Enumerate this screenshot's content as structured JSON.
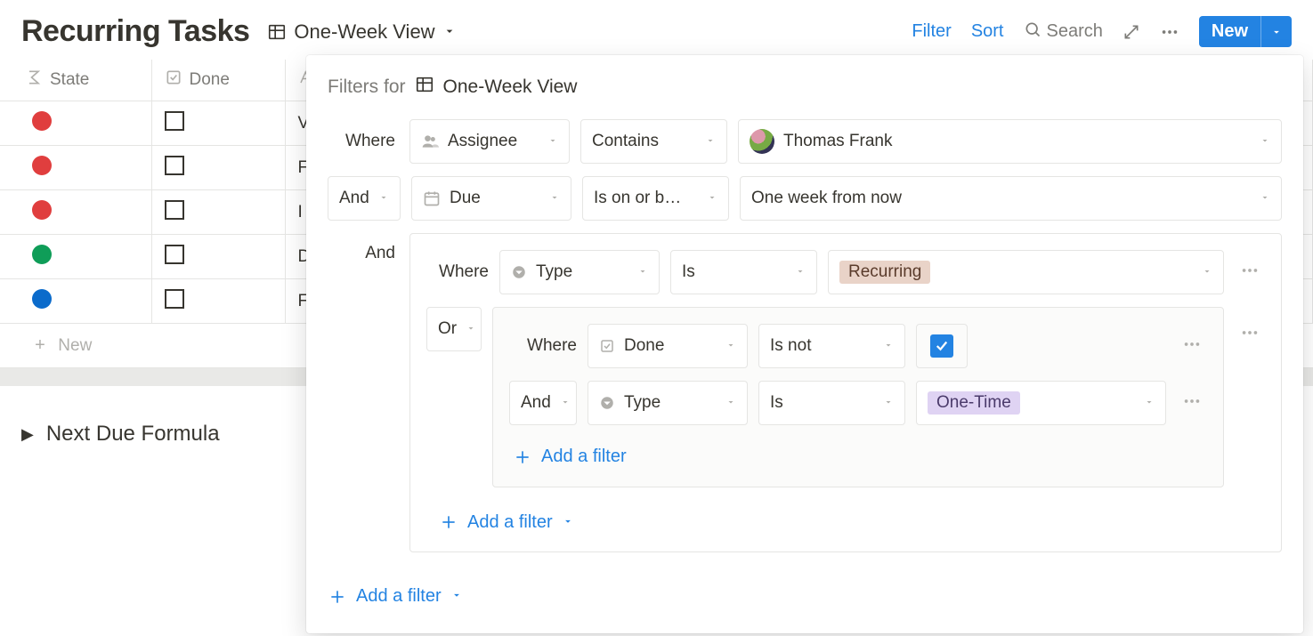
{
  "header": {
    "title": "Recurring Tasks",
    "view_name": "One-Week View",
    "toolbar": {
      "filter": "Filter",
      "sort": "Sort",
      "search": "Search",
      "new": "New"
    }
  },
  "table": {
    "columns": {
      "state": "State",
      "done": "Done",
      "third_cut": "A"
    },
    "rows": [
      {
        "state_color": "red",
        "done": false,
        "cut": "V"
      },
      {
        "state_color": "red",
        "done": false,
        "cut": "F"
      },
      {
        "state_color": "red",
        "done": false,
        "cut": "I"
      },
      {
        "state_color": "green",
        "done": false,
        "cut": "D"
      },
      {
        "state_color": "blue",
        "done": false,
        "cut": "F"
      }
    ],
    "new_row": "New"
  },
  "footer": {
    "toggle_label": "Next Due Formula"
  },
  "popover": {
    "prefix": "Filters for",
    "view_name": "One-Week View",
    "levels": {
      "where": "Where",
      "and": "And",
      "or": "Or"
    },
    "add_filter": "Add a filter",
    "rules": {
      "r1": {
        "prop": "Assignee",
        "cond": "Contains",
        "value": "Thomas Frank"
      },
      "r2": {
        "prop": "Due",
        "cond": "Is on or b…",
        "value": "One week from now"
      },
      "g1": {
        "r1": {
          "prop": "Type",
          "cond": "Is",
          "tag": "Recurring"
        },
        "g2": {
          "r1": {
            "prop": "Done",
            "cond": "Is not",
            "checked": true
          },
          "r2": {
            "prop": "Type",
            "cond": "Is",
            "tag": "One-Time"
          }
        }
      }
    }
  }
}
